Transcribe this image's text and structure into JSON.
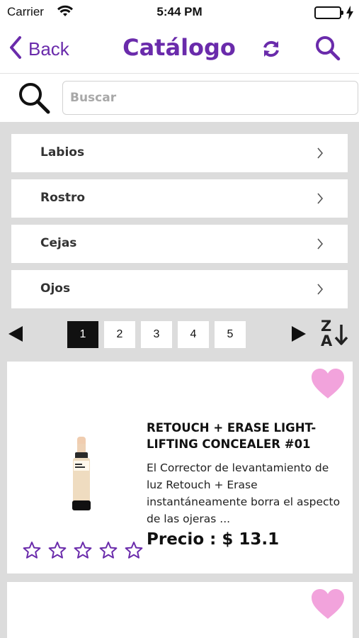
{
  "status_bar": {
    "carrier": "Carrier",
    "time": "5:44 PM"
  },
  "nav": {
    "back_label": "Back",
    "title": "Catálogo"
  },
  "search": {
    "placeholder": "Buscar"
  },
  "categories": [
    {
      "label": "Labios"
    },
    {
      "label": "Rostro"
    },
    {
      "label": "Cejas"
    },
    {
      "label": "Ojos"
    }
  ],
  "pagination": {
    "pages": [
      "1",
      "2",
      "3",
      "4",
      "5"
    ],
    "current": "1"
  },
  "sort": {
    "top": "Z",
    "bottom": "A"
  },
  "products": [
    {
      "name": "RETOUCH + ERASE LIGHT-LIFTING CONCEALER #01",
      "description": "El Corrector de levantamiento de luz Retouch + Erase instantáneamente borra el aspecto de las ojeras ...",
      "price": "Precio : $ 13.1",
      "rating": 0
    }
  ],
  "colors": {
    "accent": "#6a2bab",
    "heart": "#f2a3dc",
    "background": "#dcdcdc"
  },
  "icons": [
    "back-chevron-icon",
    "refresh-icon",
    "search-icon",
    "chevron-right-icon",
    "prev-arrow-icon",
    "next-arrow-icon",
    "sort-za-icon",
    "heart-icon",
    "star-icon"
  ]
}
